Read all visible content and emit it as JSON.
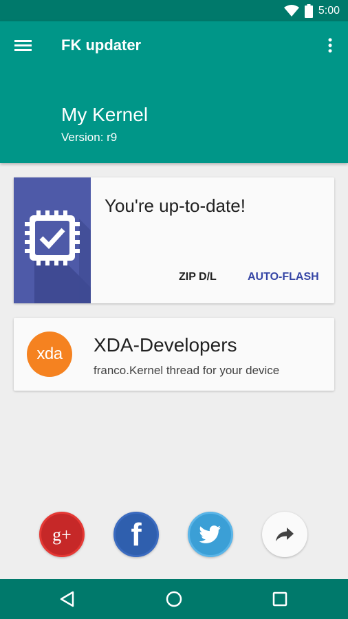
{
  "status_bar": {
    "time": "5:00"
  },
  "app_bar": {
    "title": "FK updater",
    "kernel_name": "My Kernel",
    "kernel_version": "Version: r9"
  },
  "update_card": {
    "message": "You're up-to-date!",
    "zip_button": "ZIP D/L",
    "flash_button": "AUTO-FLASH"
  },
  "xda_card": {
    "logo_text": "xda",
    "title": "XDA-Developers",
    "subtitle": "franco.Kernel thread for your device"
  },
  "social": {
    "gplus_label": "g+",
    "facebook_label": "f"
  },
  "colors": {
    "primary": "#009688",
    "primary_dark": "#00796b",
    "accent": "#3545a5",
    "xda_orange": "#f58220"
  },
  "icons": [
    "wifi-icon",
    "battery-icon",
    "menu-icon",
    "overflow-icon",
    "chip-check-icon",
    "twitter-icon",
    "share-icon",
    "back-icon",
    "home-icon",
    "recents-icon"
  ]
}
